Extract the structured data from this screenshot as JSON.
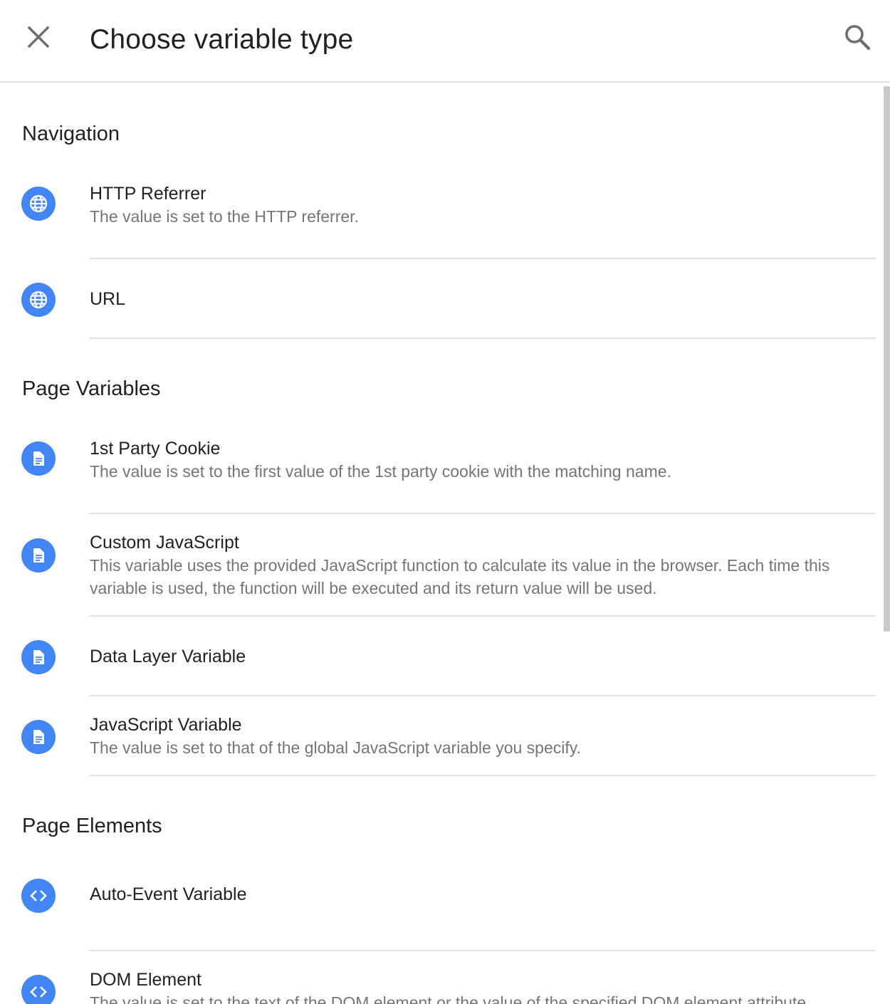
{
  "header": {
    "title": "Choose variable type",
    "close_icon": "close-icon",
    "search_icon": "search-icon"
  },
  "colors": {
    "accent": "#4285f4",
    "title_text": "#212121",
    "secondary_text": "#757575",
    "divider": "#e2e2e2"
  },
  "sections": [
    {
      "title": "Navigation",
      "items": [
        {
          "title": "HTTP Referrer",
          "description": "The value is set to the HTTP referrer.",
          "icon": "globe-icon"
        },
        {
          "title": "URL",
          "description": "",
          "icon": "globe-icon"
        }
      ]
    },
    {
      "title": "Page Variables",
      "items": [
        {
          "title": "1st Party Cookie",
          "description": "The value is set to the first value of the 1st party cookie with the matching name.",
          "icon": "document-icon"
        },
        {
          "title": "Custom JavaScript",
          "description": "This variable uses the provided JavaScript function to calculate its value in the browser. Each time this variable is used, the function will be executed and its return value will be used.",
          "icon": "document-icon"
        },
        {
          "title": "Data Layer Variable",
          "description": "",
          "icon": "document-icon"
        },
        {
          "title": "JavaScript Variable",
          "description": "The value is set to that of the global JavaScript variable you specify.",
          "icon": "document-icon"
        }
      ]
    },
    {
      "title": "Page Elements",
      "items": [
        {
          "title": "Auto-Event Variable",
          "description": "",
          "icon": "code-icon"
        },
        {
          "title": "DOM Element",
          "description": "The value is set to the text of the DOM element or the value of the specified DOM element attribute.",
          "icon": "code-icon"
        }
      ]
    }
  ]
}
